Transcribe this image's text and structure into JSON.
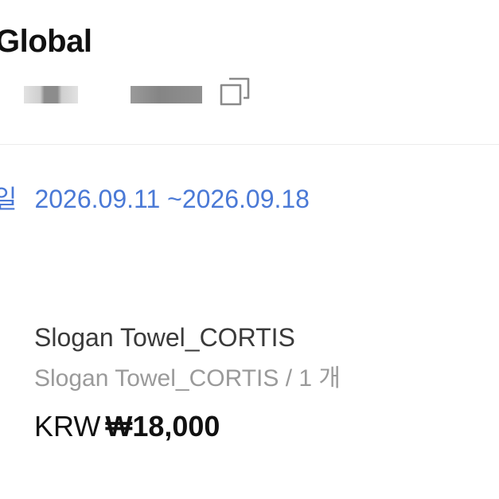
{
  "header": {
    "title": "Global",
    "copy_icon": "copy-icon"
  },
  "period": {
    "label": "일",
    "date_range": "2026.09.11 ~2026.09.18"
  },
  "product": {
    "name": "Slogan Towel_CORTIS",
    "option": "Slogan Towel_CORTIS / 1 개",
    "currency": "KRW",
    "price": "₩18,000"
  },
  "colors": {
    "accent_blue": "#4a79d6",
    "text_dark": "#111111",
    "text_muted": "#9a9a9a"
  }
}
